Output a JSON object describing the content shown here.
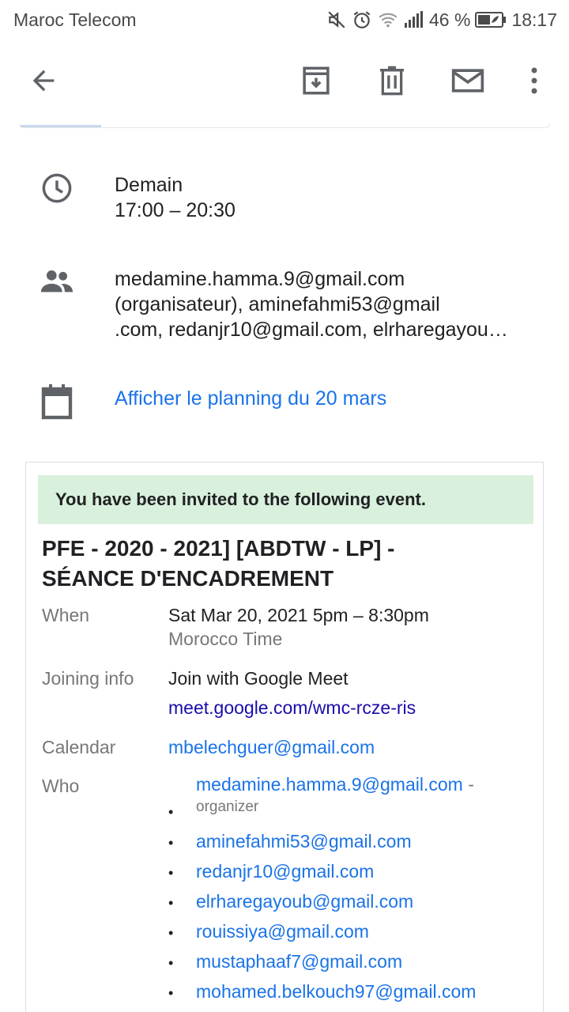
{
  "status_bar": {
    "carrier": "Maroc Telecom",
    "battery": "46 %",
    "time": "18:17",
    "icons": [
      "mute-icon",
      "alarm-icon",
      "wifi-icon",
      "signal-icon",
      "battery-icon"
    ]
  },
  "toolbar": {
    "back_icon": "arrow-back-icon",
    "archive_icon": "archive-icon",
    "delete_icon": "trash-icon",
    "mail_icon": "mail-icon",
    "more_icon": "more-vert-icon"
  },
  "event_details": {
    "day": "Demain",
    "time_range": "17:00 – 20:30",
    "attendees_line1": "medamine.hamma.9@gmail.com",
    "attendees_line2": "(organisateur), aminefahmi53@gmail",
    "attendees_line3": ".com, redanjr10@gmail.com, elrharegayou…",
    "planning_link": "Afficher le planning du 20 mars"
  },
  "email": {
    "banner": "You have been invited to the following event.",
    "title_line1": "PFE - 2020 - 2021] [ABDTW - LP] -",
    "title_line2": "SÉANCE D'ENCADREMENT",
    "when_label": "When",
    "when_value": "Sat Mar 20, 2021 5pm – 8:30pm",
    "when_timezone": "Morocco Time",
    "joining_label": "Joining info",
    "joining_value": "Join with Google Meet",
    "joining_link": "meet.google.com/wmc-rcze-ris",
    "calendar_label": "Calendar",
    "calendar_value": "mbelechguer@gmail.com",
    "who_label": "Who",
    "organizer": {
      "email": "medamine.hamma.9@gmail.com",
      "dash": " -",
      "role": "organizer"
    },
    "guests": [
      "aminefahmi53@gmail.com",
      "redanjr10@gmail.com",
      "elrharegayoub@gmail.com",
      "rouissiya@gmail.com",
      "mustaphaaf7@gmail.com",
      "mohamed.belkouch97@gmail.com"
    ]
  },
  "colors": {
    "link": "#1a73e8",
    "visited_link": "#1a0dab",
    "banner_bg": "#d9f0dc",
    "icon_gray": "#5f6368"
  }
}
